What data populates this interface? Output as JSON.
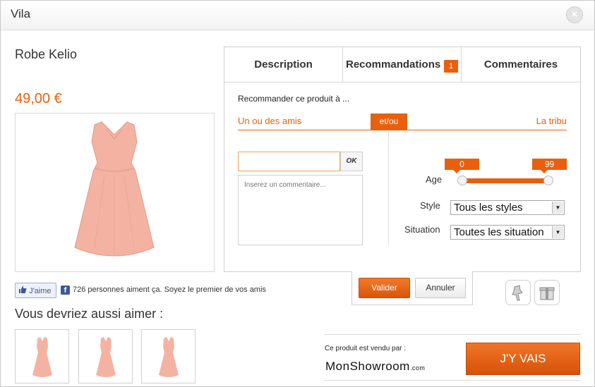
{
  "window": {
    "title": "Vila",
    "close_label": "×"
  },
  "product": {
    "name": "Robe Kelio",
    "price": "49,00 €"
  },
  "social": {
    "like_label": "J'aime",
    "fb_letter": "f",
    "like_text": "726 personnes aiment ça. Soyez le premier de vos amis"
  },
  "also_like": {
    "title": "Vous devriez aussi aimer :"
  },
  "tabs": [
    {
      "label": "Description"
    },
    {
      "label": "Recommandations",
      "badge": "1"
    },
    {
      "label": "Commentaires"
    }
  ],
  "recommend": {
    "title": "Recommander ce produit à ...",
    "left_option": "Un ou des amis",
    "join_label": "et/ou",
    "right_option": "La tribu",
    "friend_input_value": "",
    "ok_label": "OK",
    "comment_placeholder": "Inserez un commentaire...",
    "age_label": "Age",
    "age_min": "0",
    "age_max": "99",
    "age_range": [
      0,
      99
    ],
    "style_label": "Style",
    "style_value": "Tous les styles",
    "situation_label": "Situation",
    "situation_value": "Toutes les situation"
  },
  "actions": {
    "validate_label": "Valider",
    "cancel_label": "Annuler"
  },
  "seller": {
    "sold_by": "Ce produit est vendu par :",
    "brand": "MonShowroom",
    "brand_suffix": ".com",
    "go_label": "J'Y VAIS"
  },
  "colors": {
    "accent": "#e8600e",
    "dress": "#f4b3a2"
  }
}
